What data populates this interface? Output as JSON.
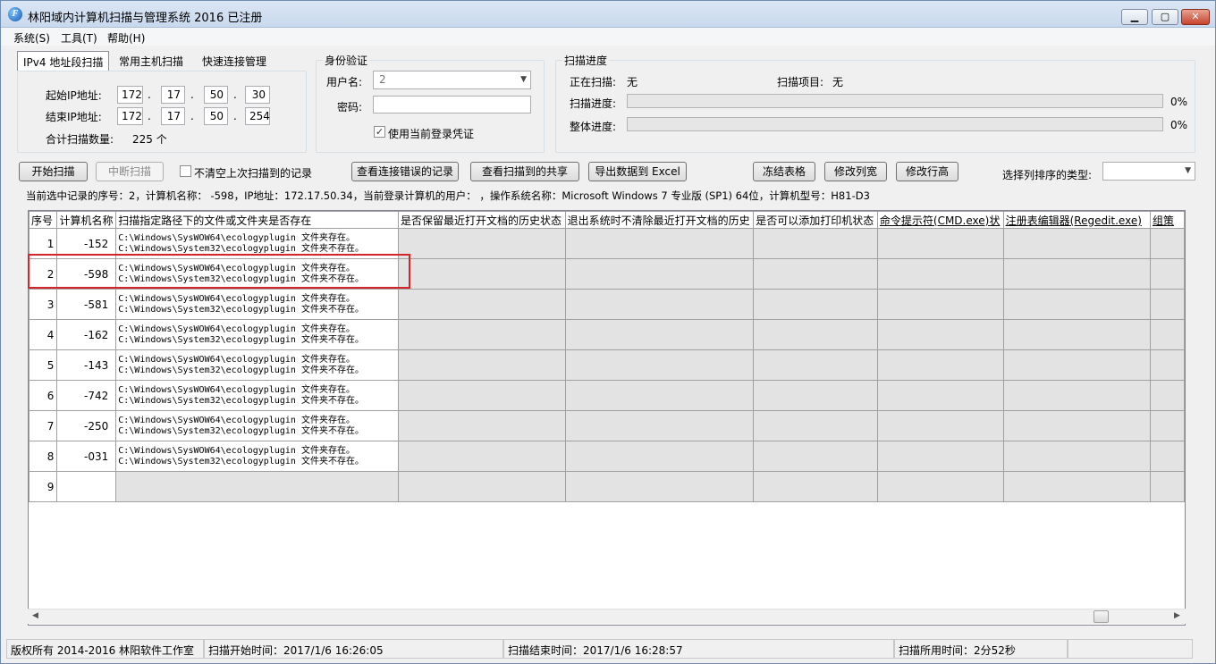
{
  "window": {
    "title": "林阳域内计算机扫描与管理系统 2016 已注册",
    "icon_glyph": "F"
  },
  "menu": {
    "system": "系统(S)",
    "tools": "工具(T)",
    "help": "帮助(H)"
  },
  "scan_tabs": {
    "ipv4": "IPv4 地址段扫描",
    "common": "常用主机扫描",
    "quick": "快速连接管理"
  },
  "ip_range": {
    "start_label": "起始IP地址:",
    "start": [
      "172",
      "17",
      "50",
      "30"
    ],
    "end_label": "结束IP地址:",
    "end": [
      "172",
      "17",
      "50",
      "254"
    ],
    "count_label": "合计扫描数量:",
    "count_value": "225 个"
  },
  "auth": {
    "title": "身份验证",
    "user_label": "用户名:",
    "user_value": "                 2",
    "password_label": "密码:",
    "use_current_label": "使用当前登录凭证",
    "use_current_checked": true
  },
  "progress": {
    "title": "扫描进度",
    "scanning_label": "正在扫描:",
    "scanning_value": "无",
    "item_label": "扫描项目:",
    "item_value": "无",
    "scan_label": "扫描进度:",
    "scan_percent": "0%",
    "overall_label": "整体进度:",
    "overall_percent": "0%",
    "scan_fraction": 0,
    "overall_fraction": 0
  },
  "toolbar": {
    "start": "开始扫描",
    "stop": "中断扫描",
    "keep_label": "不清空上次扫描到的记录",
    "view_errors": "查看连接错误的记录",
    "view_shares": "查看扫描到的共享",
    "export": "导出数据到 Excel",
    "freeze": "冻结表格",
    "col_width": "修改列宽",
    "row_height": "修改行高",
    "sort_label": "选择列排序的类型:"
  },
  "selection_info": "当前选中记录的序号：2，计算机名称：        -598，IP地址：172.17.50.34，当前登录计算机的用户：                  ，操作系统名称：Microsoft Windows 7 专业版 (SP1) 64位，计算机型号：H81-D3",
  "grid": {
    "columns": [
      "序号",
      "计算机名称",
      "扫描指定路径下的文件或文件夹是否存在",
      "是否保留最近打开文档的历史状态",
      "退出系统时不清除最近打开文档的历史",
      "是否可以添加打印机状态",
      "命令提示符(CMD.exe)状",
      "注册表编辑器(Regedit.exe)",
      "组策"
    ],
    "rows": [
      {
        "no": "1",
        "name": "-152",
        "path1": "C:\\Windows\\SysWOW64\\ecologyplugin 文件夹存在。",
        "path2": "C:\\Windows\\System32\\ecologyplugin 文件夹不存在。"
      },
      {
        "no": "2",
        "name": "-598",
        "path1": "C:\\Windows\\SysWOW64\\ecologyplugin 文件夹存在。",
        "path2": "C:\\Windows\\System32\\ecologyplugin 文件夹不存在。"
      },
      {
        "no": "3",
        "name": "-581",
        "path1": "C:\\Windows\\SysWOW64\\ecologyplugin 文件夹存在。",
        "path2": "C:\\Windows\\System32\\ecologyplugin 文件夹不存在。"
      },
      {
        "no": "4",
        "name": "-162",
        "path1": "C:\\Windows\\SysWOW64\\ecologyplugin 文件夹存在。",
        "path2": "C:\\Windows\\System32\\ecologyplugin 文件夹不存在。"
      },
      {
        "no": "5",
        "name": "-143",
        "path1": "C:\\Windows\\SysWOW64\\ecologyplugin 文件夹存在。",
        "path2": "C:\\Windows\\System32\\ecologyplugin 文件夹不存在。"
      },
      {
        "no": "6",
        "name": "-742",
        "path1": "C:\\Windows\\SysWOW64\\ecologyplugin 文件夹存在。",
        "path2": "C:\\Windows\\System32\\ecologyplugin 文件夹不存在。"
      },
      {
        "no": "7",
        "name": "-250",
        "path1": "C:\\Windows\\SysWOW64\\ecologyplugin 文件夹存在。",
        "path2": "C:\\Windows\\System32\\ecologyplugin 文件夹不存在。"
      },
      {
        "no": "8",
        "name": "-031",
        "path1": "C:\\Windows\\SysWOW64\\ecologyplugin 文件夹存在。",
        "path2": "C:\\Windows\\System32\\ecologyplugin 文件夹不存在。"
      },
      {
        "no": "9",
        "name": "",
        "path1": "",
        "path2": ""
      }
    ],
    "selected_row": 2
  },
  "status": {
    "copyright": "版权所有 2014-2016 林阳软件工作室",
    "start_time": "扫描开始时间：2017/1/6 16:26:05",
    "end_time": "扫描结束时间：2017/1/6 16:28:57",
    "duration": "扫描所用时间：2分52秒"
  },
  "colors": {
    "highlight": "#d4262a",
    "titlebar": "#c9d9ee"
  }
}
